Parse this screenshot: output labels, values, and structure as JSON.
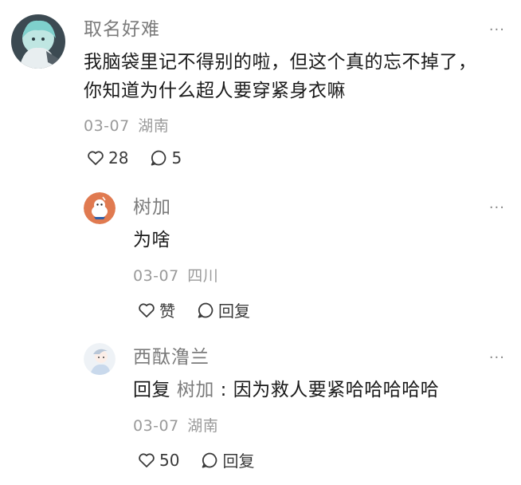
{
  "comments": [
    {
      "user": "取名好难",
      "avatar": "avatar-anime-silver",
      "more": "···",
      "text_lines": [
        "我脑袋里记不得别的啦，但这个真的忘不掉了，",
        "你知道为什么超人要穿紧身衣嘛"
      ],
      "date": "03-07",
      "location": "湖南",
      "likes": "28",
      "replies": "5"
    },
    {
      "user": "树加",
      "avatar": "avatar-cartoon-orange",
      "more": "···",
      "text": "为啥",
      "date": "03-07",
      "location": "四川",
      "like_label": "赞",
      "reply_label": "回复"
    },
    {
      "user": "西酞澛兰",
      "avatar": "avatar-sketch-girl",
      "more": "···",
      "reply_prefix": "回复",
      "mention": "树加",
      "separator": ":",
      "text": "因为救人要紧哈哈哈哈哈",
      "date": "03-07",
      "location": "湖南",
      "likes": "50",
      "reply_label": "回复"
    }
  ],
  "colors": {
    "username": "#7b7b7b",
    "body": "#1a1a1a",
    "meta": "#9a9a9a",
    "icon": "#3a3a3a",
    "avatar_orange": "#e07a50"
  }
}
